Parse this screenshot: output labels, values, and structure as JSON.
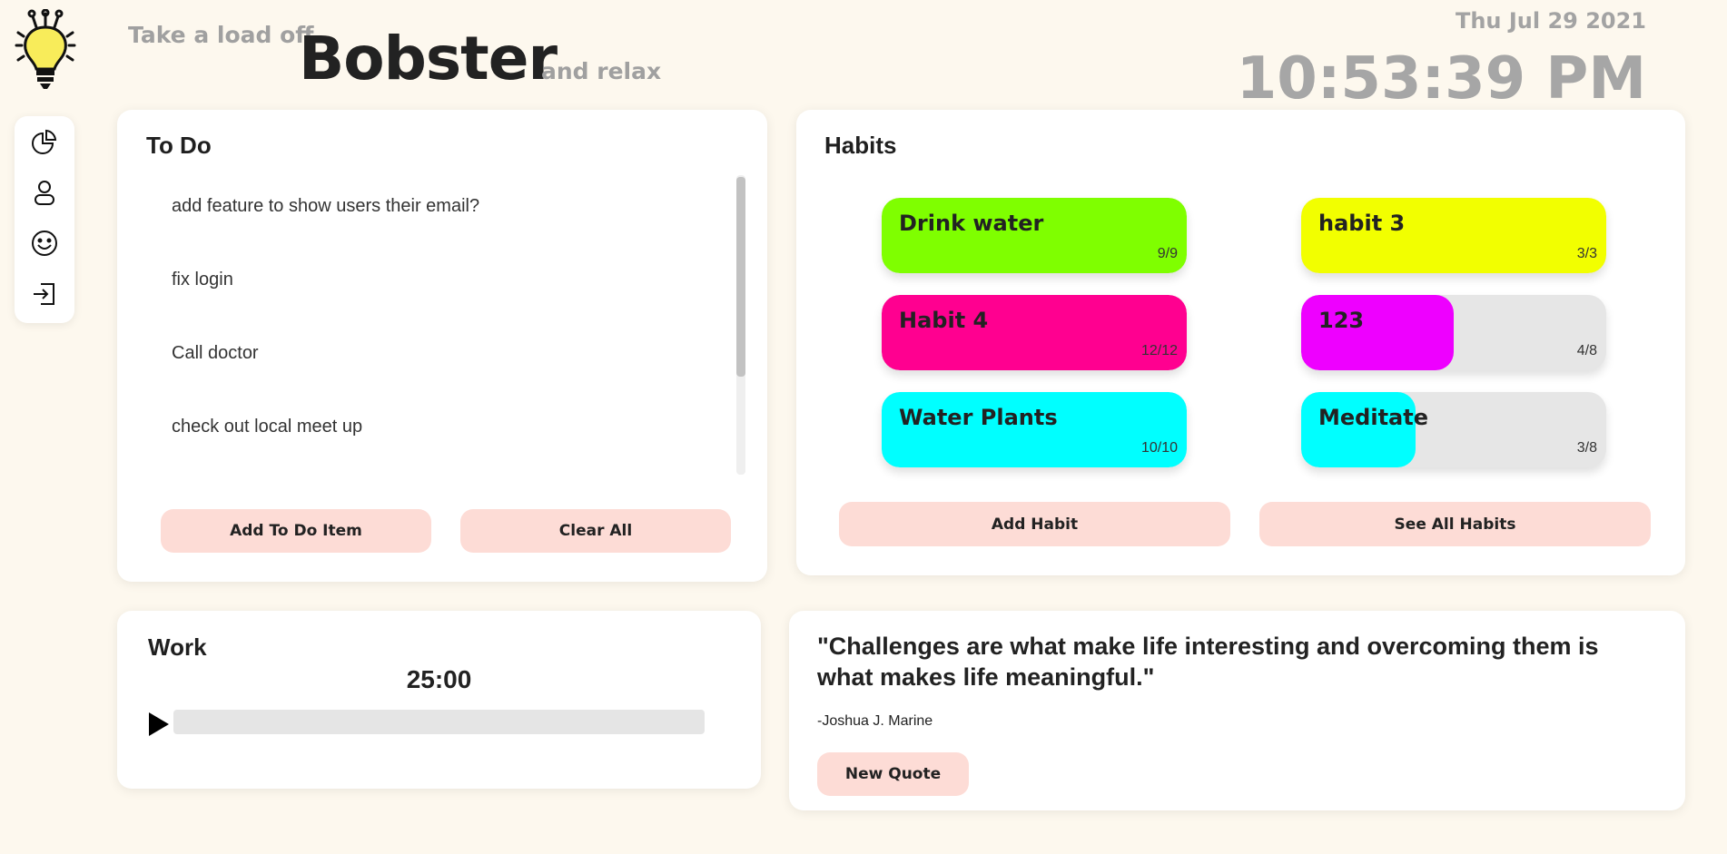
{
  "header": {
    "tagline_pre": "Take a load off",
    "brand": "Bobster",
    "tagline_post": "and relax",
    "date": "Thu Jul 29 2021",
    "time": "10:53:39 PM",
    "logo_icon": "lightbulb-icon"
  },
  "sidebar": {
    "items": [
      {
        "icon": "pie-chart-icon"
      },
      {
        "icon": "user-icon"
      },
      {
        "icon": "smiley-icon"
      },
      {
        "icon": "login-icon"
      }
    ]
  },
  "todo": {
    "title": "To Do",
    "items": [
      "add feature to show users their email?",
      "fix login",
      "Call doctor",
      "check out local meet up"
    ],
    "add_label": "Add To Do Item",
    "clear_label": "Clear All"
  },
  "habits": {
    "title": "Habits",
    "items": [
      {
        "name": "Drink water",
        "count": "9/9",
        "done": 9,
        "total": 9,
        "color": "#7fff00"
      },
      {
        "name": "habit 3",
        "count": "3/3",
        "done": 3,
        "total": 3,
        "color": "#f2ff00"
      },
      {
        "name": "Habit 4",
        "count": "12/12",
        "done": 12,
        "total": 12,
        "color": "#ff0090"
      },
      {
        "name": "123",
        "count": "4/8",
        "done": 4,
        "total": 8,
        "color": "#ee00ff"
      },
      {
        "name": "Water Plants",
        "count": "10/10",
        "done": 10,
        "total": 10,
        "color": "#00ffff"
      },
      {
        "name": "Meditate",
        "count": "3/8",
        "done": 3,
        "total": 8,
        "color": "#00ffff"
      }
    ],
    "add_label": "Add Habit",
    "see_all_label": "See All Habits"
  },
  "work": {
    "title": "Work",
    "timer": "25:00",
    "progress": 0
  },
  "quote": {
    "text": "\"Challenges are what make life interesting and overcoming them is what makes life meaningful.\"",
    "author": "-Joshua J. Marine",
    "button_label": "New Quote"
  },
  "colors": {
    "background": "#fdf8ee",
    "button": "#fddcd6"
  }
}
